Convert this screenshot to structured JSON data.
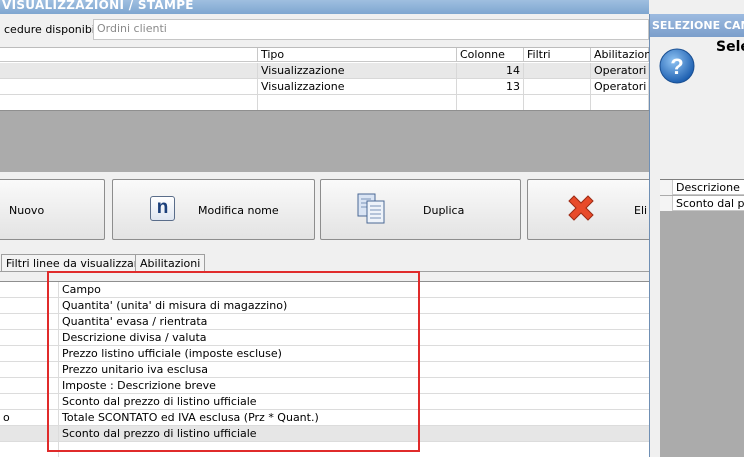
{
  "main_window": {
    "title": "VISUALIZZAZIONI / STAMPE",
    "procedures_label": "cedure disponibili :",
    "procedures_value": "Ordini clienti"
  },
  "layouts_table": {
    "columns": [
      "Tipo",
      "Colonne",
      "Filtri",
      "Abilitazioni"
    ],
    "rows": [
      {
        "tipo": "Visualizzazione",
        "colonne": "14",
        "filtri": "",
        "abilitazioni": "Operatori"
      },
      {
        "tipo": "Visualizzazione",
        "colonne": "13",
        "filtri": "",
        "abilitazioni": "Operatori"
      }
    ]
  },
  "toolbar": {
    "nuovo_label": "Nuovo",
    "modifica_label": "Modifica nome",
    "modifica_icon_glyph": "n",
    "duplica_label": "Duplica",
    "elimina_label": "Eli"
  },
  "tabs": [
    {
      "label": "Filtri linee da visualizzare"
    },
    {
      "label": "Abilitazioni"
    }
  ],
  "fields_table": {
    "header": "Campo",
    "rows": [
      {
        "left": "",
        "campo": "Quantita' (unita' di misura di magazzino)"
      },
      {
        "left": "",
        "campo": "Quantita' evasa / rientrata"
      },
      {
        "left": "",
        "campo": "Descrizione divisa / valuta"
      },
      {
        "left": "",
        "campo": "Prezzo listino ufficiale (imposte escluse)"
      },
      {
        "left": "",
        "campo": "Prezzo unitario iva esclusa"
      },
      {
        "left": "",
        "campo": "Imposte : Descrizione breve"
      },
      {
        "left": "",
        "campo": "Sconto dal prezzo di listino ufficiale"
      },
      {
        "left": "o",
        "campo": "Totale SCONTATO ed IVA esclusa (Prz * Quant.)"
      },
      {
        "left": "",
        "campo": "Sconto dal prezzo di listino ufficiale"
      }
    ],
    "selected_index": 8
  },
  "dialog": {
    "title": "SELEZIONE CAMPI",
    "heading": "Sele",
    "grid_header": "Descrizione",
    "grid_row": "Sconto dal prezzo"
  },
  "colors": {
    "highlight_border": "#e02b2b",
    "title_bar": "#8fb2d8",
    "empty_grid_area": "#ababab"
  },
  "icons": {
    "duplica": "copy-pages-icon",
    "elimina": "red-x-icon",
    "dialog": "question-icon"
  }
}
